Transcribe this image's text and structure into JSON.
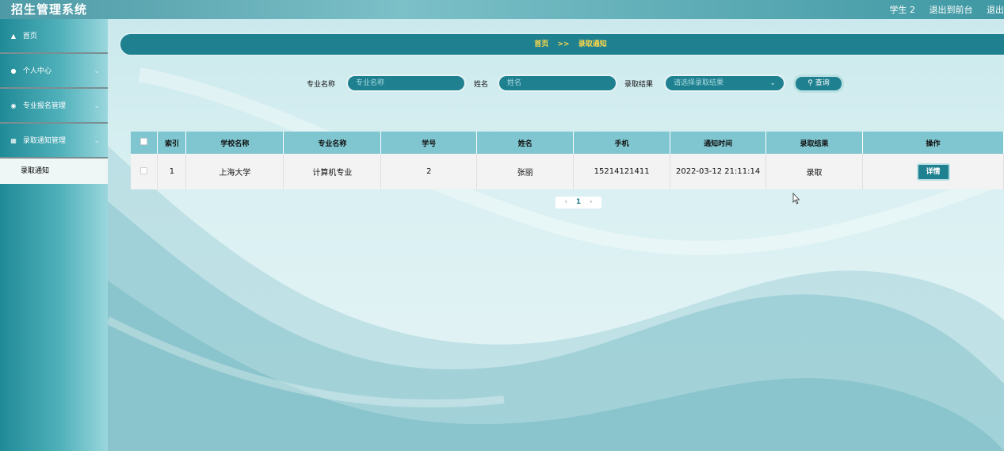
{
  "header": {
    "title": "招生管理系统",
    "user": "学生 2",
    "back_front": "退出到前台",
    "logout": "退出"
  },
  "sidebar": {
    "items": [
      {
        "label": "首页",
        "icon": "home-icon"
      },
      {
        "label": "个人中心",
        "icon": "user-icon"
      },
      {
        "label": "专业报名管理",
        "icon": "pin-icon"
      },
      {
        "label": "录取通知管理",
        "icon": "list-icon"
      }
    ],
    "sub_item": "录取通知"
  },
  "breadcrumb": {
    "home": "首页",
    "sep": ">>",
    "current": "录取通知"
  },
  "search": {
    "major_label": "专业名称",
    "major_placeholder": "专业名称",
    "name_label": "姓名",
    "name_placeholder": "姓名",
    "result_label": "录取结果",
    "result_placeholder": "请选择录取结果",
    "query_label": "查询"
  },
  "table": {
    "headers": [
      "索引",
      "学校名称",
      "专业名称",
      "学号",
      "姓名",
      "手机",
      "通知时间",
      "录取结果",
      "操作"
    ],
    "rows": [
      {
        "index": "1",
        "school": "上海大学",
        "major": "计算机专业",
        "student_id": "2",
        "name": "张丽",
        "phone": "15214121411",
        "time": "2022-03-12 21:11:14",
        "result": "录取",
        "action": "详情"
      }
    ]
  },
  "pagination": {
    "prev": "‹",
    "page": "1",
    "next": "›"
  },
  "colors": {
    "accent": "#1f8090",
    "breadcrumb_text": "#ffd84a",
    "table_header": "#7fc6d0"
  }
}
